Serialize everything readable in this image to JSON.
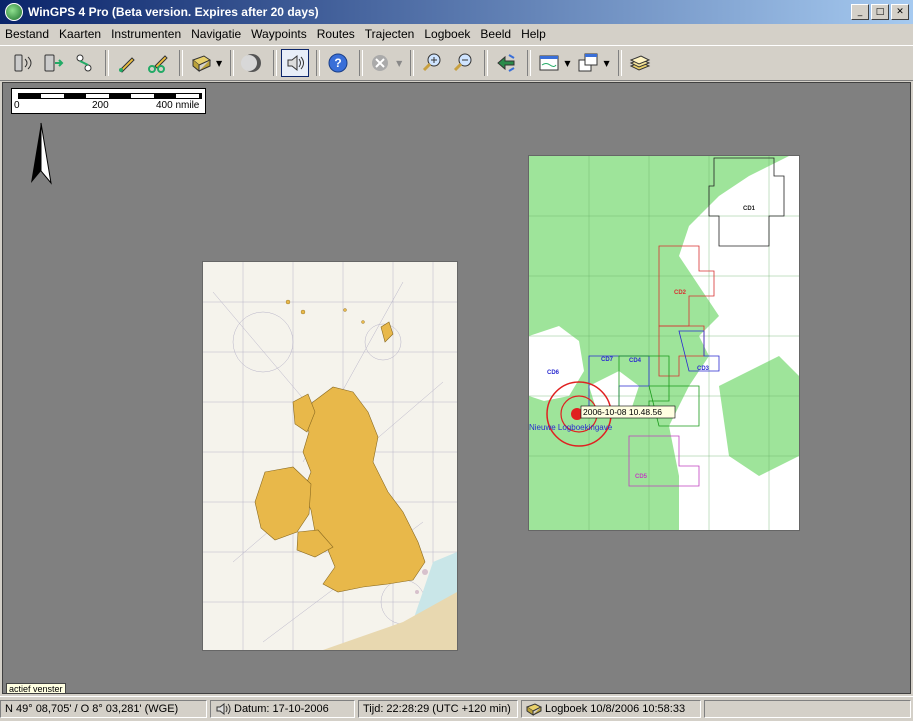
{
  "window": {
    "title": "WinGPS 4 Pro (Beta version. Expires after 20 days)"
  },
  "menu": [
    "Bestand",
    "Kaarten",
    "Instrumenten",
    "Navigatie",
    "Waypoints",
    "Routes",
    "Trajecten",
    "Logboek",
    "Beeld",
    "Help"
  ],
  "toolbar": {
    "buttons": [
      "instrument-gps-icon",
      "instrument-log-icon",
      "instrument-route-icon",
      "pencil-icon",
      "track-icon",
      "book-icon",
      "moon-icon",
      "speaker-icon",
      "help-icon",
      "close-mark-icon",
      "zoom-in-icon",
      "zoom-out-icon",
      "waypoint-arrow-icon",
      "window-icon",
      "windows-icon",
      "chart-stack-icon"
    ]
  },
  "map": {
    "scale": {
      "labels": [
        "0",
        "200",
        "400 nmile"
      ]
    },
    "charts": {
      "baltic": {
        "labels": [
          "CD1",
          "CD2",
          "CD7",
          "CD4",
          "CD3",
          "CD6",
          "CD5"
        ],
        "logbook_label": "2006-10-08 10.48.56",
        "new_logbook_label": "Nieuwe Logboekingave"
      }
    },
    "active_window_label": "actief venster"
  },
  "status": {
    "position": "N 49° 08,705' / O 8° 03,281' (WGE)",
    "datum": "Datum: 17-10-2006",
    "time": "Tijd: 22:28:29 (UTC +120 min)",
    "logbook": "Logboek 10/8/2006 10:58:33"
  },
  "colors": {
    "title_start": "#0a246a",
    "title_end": "#a6caf0",
    "map_background": "#808080",
    "land_uk": "#e8b84a",
    "land_baltic": "#9ee49a",
    "sea_baltic": "#ffffff",
    "marker_red": "#e02020"
  }
}
